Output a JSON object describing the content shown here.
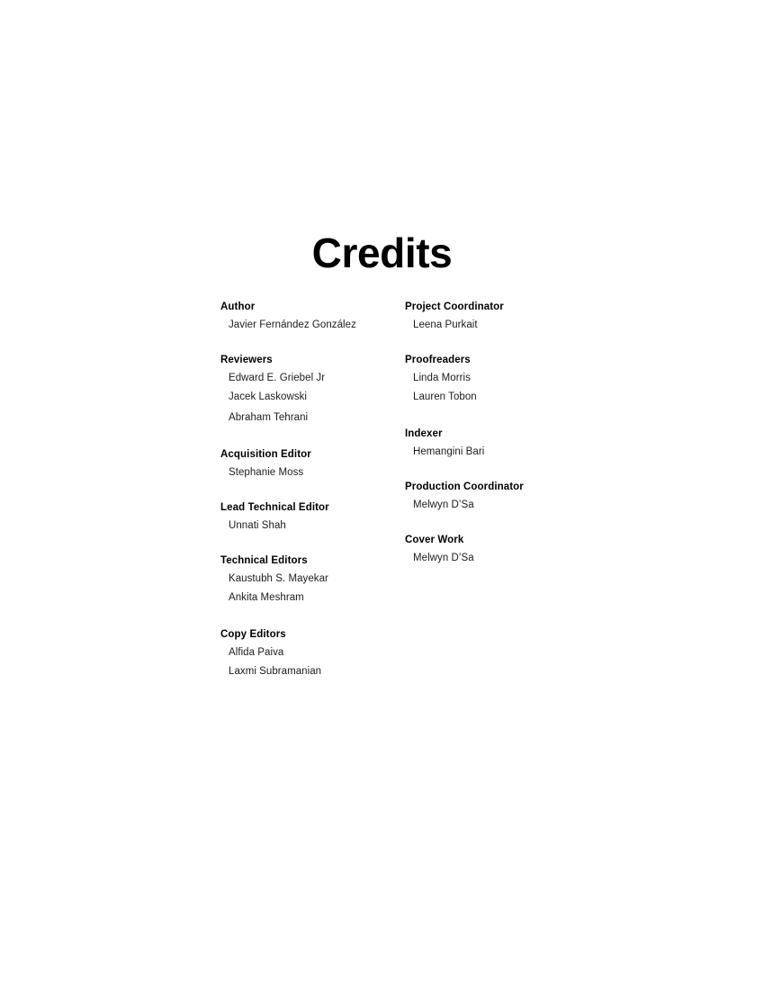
{
  "page": {
    "title": "Credits",
    "background_color": "#ffffff",
    "text_color": "#000000",
    "name_color": "#1c1c1c"
  },
  "columns": {
    "left": {
      "groups": [
        {
          "role": "Author",
          "names": [
            "Javier Fernández González"
          ]
        },
        {
          "role": "Reviewers",
          "names": [
            "Edward E. Griebel Jr",
            "Jacek Laskowski",
            "Abraham Tehrani"
          ]
        },
        {
          "role": "Acquisition Editor",
          "names": [
            "Stephanie Moss"
          ]
        },
        {
          "role": "Lead Technical Editor",
          "names": [
            "Unnati Shah"
          ]
        },
        {
          "role": "Technical Editors",
          "names": [
            "Kaustubh S. Mayekar",
            "Ankita Meshram"
          ]
        },
        {
          "role": "Copy Editors",
          "names": [
            "Alfida Paiva",
            "Laxmi Subramanian"
          ]
        }
      ]
    },
    "right": {
      "groups": [
        {
          "role": "Project Coordinator",
          "names": [
            "Leena Purkait"
          ]
        },
        {
          "role": "Proofreaders",
          "names": [
            "Linda Morris",
            "Lauren Tobon"
          ]
        },
        {
          "role": "Indexer",
          "names": [
            "Hemangini Bari"
          ]
        },
        {
          "role": "Production Coordinator",
          "names": [
            "Melwyn D’Sa"
          ]
        },
        {
          "role": "Cover Work",
          "names": [
            "Melwyn D’Sa"
          ]
        }
      ]
    }
  }
}
